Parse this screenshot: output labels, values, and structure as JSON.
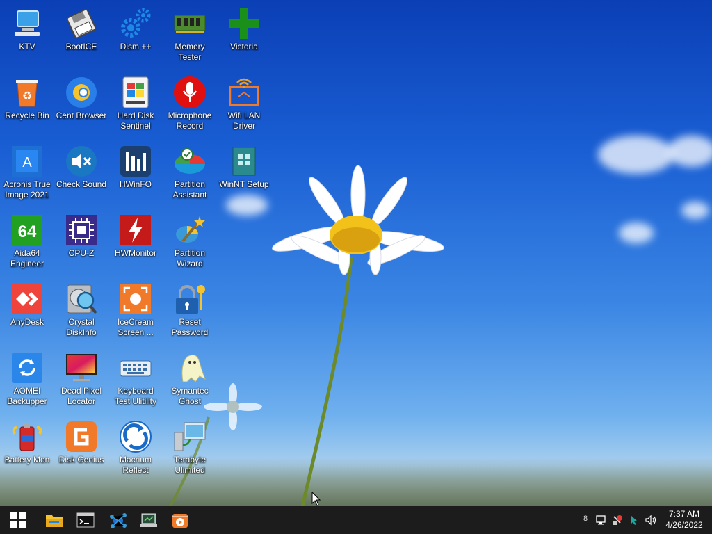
{
  "desktop_icons": [
    {
      "label": "KTV",
      "icon": "computer-icon"
    },
    {
      "label": "BootICE",
      "icon": "floppy-icon"
    },
    {
      "label": "Dism ++",
      "icon": "gears-icon"
    },
    {
      "label": "Memory Tester",
      "icon": "ram-icon"
    },
    {
      "label": "Victoria",
      "icon": "green-cross-icon"
    },
    {
      "label": "Recycle Bin",
      "icon": "recycle-bin-icon"
    },
    {
      "label": "Cent Browser",
      "icon": "cent-browser-icon"
    },
    {
      "label": "Hard Disk Sentinel",
      "icon": "hard-disk-icon"
    },
    {
      "label": "Microphone Record",
      "icon": "microphone-icon"
    },
    {
      "label": "Wifi LAN Driver",
      "icon": "wifi-icon"
    },
    {
      "label": "Acronis True Image 2021",
      "icon": "acronis-icon"
    },
    {
      "label": "Check Sound",
      "icon": "speaker-mute-icon"
    },
    {
      "label": "HWinFO",
      "icon": "hwinfo-icon"
    },
    {
      "label": "Partition Assistant",
      "icon": "partition-assistant-icon"
    },
    {
      "label": "WinNT Setup",
      "icon": "winnt-setup-icon"
    },
    {
      "label": "Aida64 Engineer",
      "icon": "aida64-icon"
    },
    {
      "label": "CPU-Z",
      "icon": "cpu-icon"
    },
    {
      "label": "HWMonitor",
      "icon": "hwmonitor-icon"
    },
    {
      "label": "Partition Wizard",
      "icon": "partition-wizard-icon"
    },
    {
      "label": "AnyDesk",
      "icon": "anydesk-icon"
    },
    {
      "label": "Crystal DiskInfo",
      "icon": "crystal-diskinfo-icon"
    },
    {
      "label": "IceCream Screen ...",
      "icon": "icecream-icon"
    },
    {
      "label": "Reset Password",
      "icon": "lock-key-icon"
    },
    {
      "label": "AOMEI Backupper",
      "icon": "aomei-icon"
    },
    {
      "label": "Dead Pixel Locator",
      "icon": "monitor-icon"
    },
    {
      "label": "Keyboard Test Ulitility",
      "icon": "keyboard-icon"
    },
    {
      "label": "Symantec Ghost",
      "icon": "ghost-icon"
    },
    {
      "label": "Battery Mon",
      "icon": "battery-icon"
    },
    {
      "label": "Disk Genius",
      "icon": "disk-genius-icon"
    },
    {
      "label": "Macrium Reflect",
      "icon": "macrium-icon"
    },
    {
      "label": "Terabyte Ulimited",
      "icon": "terabyte-icon"
    }
  ],
  "taskbar": {
    "pinned": [
      {
        "icon": "start-icon"
      },
      {
        "icon": "file-explorer-icon"
      },
      {
        "icon": "terminal-icon"
      },
      {
        "icon": "network-app-icon"
      },
      {
        "icon": "system-tool-icon"
      },
      {
        "icon": "media-player-icon"
      }
    ],
    "tray": {
      "badge_count": "8",
      "time": "7:37 AM",
      "date": "4/26/2022"
    }
  }
}
